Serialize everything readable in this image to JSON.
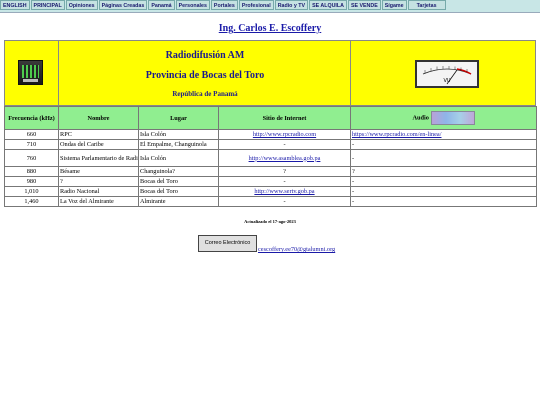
{
  "nav": [
    "ENGLISH",
    "PRINCIPAL",
    "Opiniones",
    "Páginas Creadas",
    "Panamá",
    "Personales",
    "Portales",
    "Profesional",
    "Radio y TV",
    "SE ALQUILA",
    "SE VENDE",
    "Sígame",
    "Tarjetas"
  ],
  "site_title": "Ing. Carlos E. Escoffery",
  "header": {
    "line1": "Radiodifusión AM",
    "line2": "Provincia de Bocas del Toro",
    "line3": "República de Panamá",
    "left_icon": "radio-equalizer-icon",
    "right_icon": "vu-meter-icon"
  },
  "table": {
    "headers": [
      "Frecuencia (kHz)",
      "Nombre",
      "Lugar",
      "Sitio de Internet",
      "Audio"
    ],
    "rows": [
      {
        "freq": "660",
        "name": "RPC",
        "place": "Isla Colón",
        "site": "http://www.rpcradio.com",
        "audio": "https://www.rpcradio.com/en-linea/"
      },
      {
        "freq": "710",
        "name": "Ondas del Caribe",
        "place": "El Empalme, Changuinola",
        "site": "-",
        "audio": "-"
      },
      {
        "freq": "760",
        "name": "Sistema Parlamentario de Radio y Televisión",
        "place": "Isla Colón",
        "site": "http://www.asamblea.gob.pa",
        "audio": "-"
      },
      {
        "freq": "880",
        "name": "Bésame",
        "place": "Changuinola?",
        "site": "?",
        "audio": "?"
      },
      {
        "freq": "980",
        "name": "?",
        "place": "Bocas del Toro",
        "site": "-",
        "audio": "-"
      },
      {
        "freq": "1,010",
        "name": "Radio Nacional",
        "place": "Bocas del Toro",
        "site": "http://www.sertv.gob.pa",
        "audio": "-"
      },
      {
        "freq": "1,460",
        "name": "La Voz del Almirante",
        "place": "Almirante",
        "site": "-",
        "audio": "-"
      }
    ]
  },
  "updated": "Actualizado el 17-ago-2023",
  "mail_button": "Correo Electrónico",
  "mail_link": "cescoffery.ee70@gtalumni.org",
  "colors": {
    "header_bg": "#ffff00",
    "table_header_bg": "#90ee90",
    "nav_bg": "#c5e2e2",
    "link": "#1a1aa8"
  }
}
